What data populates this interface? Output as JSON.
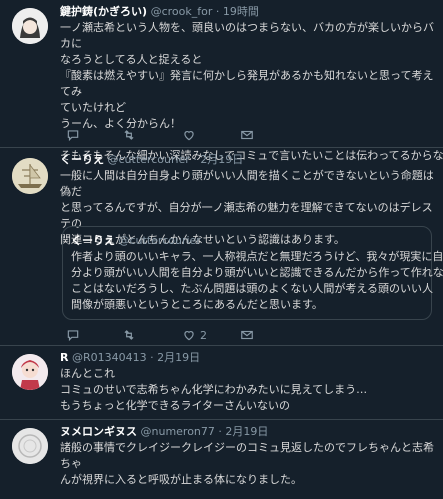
{
  "tweets": [
    {
      "name": "鍵护鋳(かぎろい)",
      "handle": "@crook_for",
      "sep": "·",
      "time": "19時間",
      "lines": [
        "一ノ瀬志希という人物を、頭良いのはつまらない、バカの方が楽しいからバカに",
        "なろうとしてる人と捉えると",
        "『酸素は燃えやすい』発言に何かしら発見があるかも知れないと思って考えてみ",
        "ていたけれど",
        "うーん、よく分からん！",
        "",
        "そもそもそんな細かい深読みなしでコミュで言いたいことは伝わってるからなあ"
      ]
    },
    {
      "name": "くーりえ",
      "handle": "@cuttercourier",
      "sep": "·",
      "time": "2月19日",
      "lines": [
        "一般に人間は自分自身より頭がいい人間を描くことができないという命題は偽だ",
        "と思ってるんですが、自分が一ノ瀬志希の魅力を理解できてないのはデレステの",
        "関連コミュがとんちんかんなせいという認識はあります。"
      ],
      "quote": {
        "name": "くーりえ",
        "handle": "@cuttercourier",
        "lines": [
          "作者より頭のいいキャラ、一人称視点だと無理だろうけど、我々が現実に自",
          "分より頭がいい人間を自分より頭がいいと認識できるんだから作って作れない",
          "ことはないだろうし、たぶん問題は頭のよくない人間が考える頭のいい人",
          "間像が頭悪いというところにあるんだと思います。"
        ]
      },
      "retweet_count": "2"
    },
    {
      "name": "R",
      "handle": "@R01340413",
      "sep": "·",
      "time": "2月19日",
      "lines": [
        "ほんとこれ",
        "コミュのせいで志希ちゃん化学にわかみたいに見えてしまう…",
        "もうちょっと化学できるライターさんいないの"
      ]
    },
    {
      "name": "ヌメロンギヌス",
      "handle": "@numeron77",
      "sep": "·",
      "time": "2月19日",
      "lines": [
        "諸般の事情でクレイジークレイジーのコミュ見返したのでフレちゃんと志希ちゃ",
        "んが視界に入ると呼吸が止まる体になりました。"
      ]
    }
  ],
  "icons": [
    "reply-icon",
    "retweet-icon",
    "like-icon",
    "message-icon"
  ],
  "colors": {
    "background": "#15202b",
    "divider": "#38444d",
    "secondary": "#8899a6"
  }
}
